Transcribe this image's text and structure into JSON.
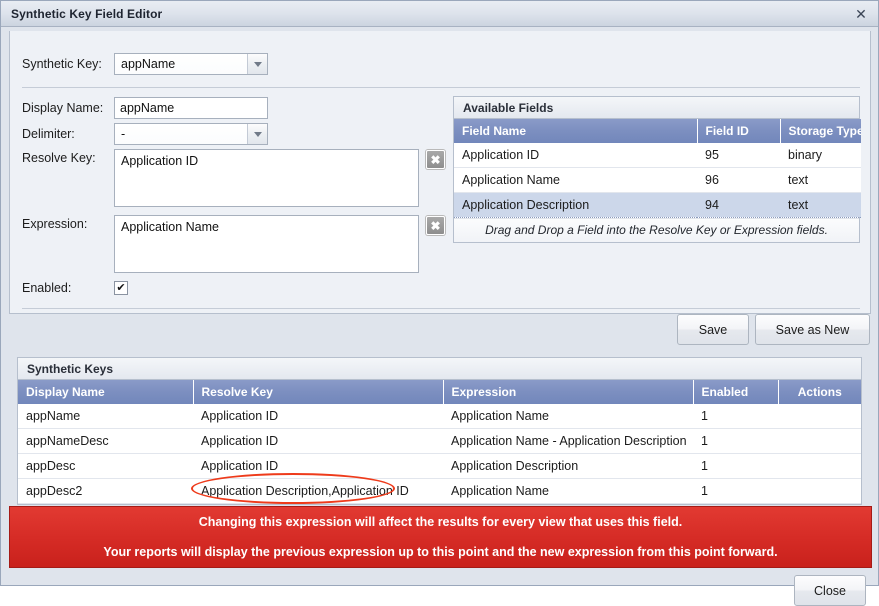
{
  "window": {
    "title": "Synthetic Key Field Editor",
    "close_icon": "close-icon",
    "close_glyph": "✕"
  },
  "form": {
    "synthetic_key": {
      "label": "Synthetic Key:",
      "value": "appName"
    },
    "display_name": {
      "label": "Display Name:",
      "value": "appName"
    },
    "delimiter": {
      "label": "Delimiter:",
      "value": "-"
    },
    "resolve_key": {
      "label": "Resolve Key:",
      "value": "Application ID",
      "clear_glyph": "✖"
    },
    "expression": {
      "label": "Expression:",
      "value": "Application Name",
      "clear_glyph": "✖"
    },
    "enabled": {
      "label": "Enabled:",
      "checked": true,
      "check_glyph": "✔"
    },
    "save_label": "Save",
    "save_as_new_label": "Save as New"
  },
  "available_fields": {
    "caption": "Available Fields",
    "columns": [
      "Field Name",
      "Field ID",
      "Storage Type"
    ],
    "rows": [
      {
        "field_name": "Application ID",
        "field_id": "95",
        "storage_type": "binary",
        "selected": false
      },
      {
        "field_name": "Application Name",
        "field_id": "96",
        "storage_type": "text",
        "selected": false
      },
      {
        "field_name": "Application Description",
        "field_id": "94",
        "storage_type": "text",
        "selected": true
      }
    ],
    "footnote": "Drag and Drop a Field into the Resolve Key or Expression fields."
  },
  "synthetic_keys": {
    "caption": "Synthetic Keys",
    "columns": [
      "Display Name",
      "Resolve Key",
      "Expression",
      "Enabled",
      "Actions"
    ],
    "rows": [
      {
        "display_name": "appName",
        "resolve_key": "Application ID",
        "expression": "Application Name",
        "enabled": "1",
        "actions": ""
      },
      {
        "display_name": "appNameDesc",
        "resolve_key": "Application ID",
        "expression": "Application Name - Application Description",
        "enabled": "1",
        "actions": ""
      },
      {
        "display_name": "appDesc",
        "resolve_key": "Application ID",
        "expression": "Application Description",
        "enabled": "1",
        "actions": ""
      },
      {
        "display_name": "appDesc2",
        "resolve_key": "Application Description,Application ID",
        "expression": "Application Name",
        "enabled": "1",
        "actions": ""
      }
    ]
  },
  "warning": {
    "line1": "Changing this expression will affect the results for every view that uses this field.",
    "line2": "Your reports will display the previous expression up to this point and the new expression from this point forward."
  },
  "footer": {
    "close_label": "Close"
  },
  "annotation": {
    "shape": "ellipse",
    "color": "#ee3b1b",
    "target": "Application Description,Application ID"
  },
  "colors": {
    "accent_header": "#7c8fc0",
    "warning_red": "#d52b25",
    "annotation_red": "#ee3b1b",
    "panel_bg": "#eef1f6",
    "dialog_bg": "#dfe4ec",
    "selected_row": "#ccd7ea"
  }
}
